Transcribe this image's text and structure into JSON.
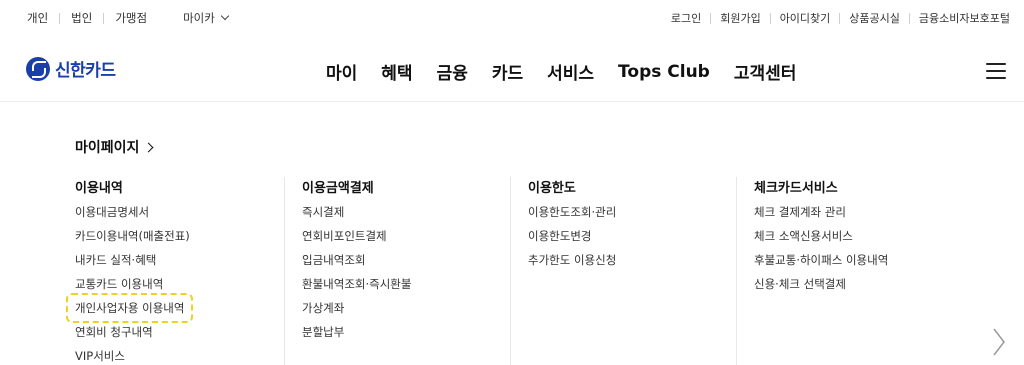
{
  "utility": {
    "left": [
      "개인",
      "법인",
      "가맹점"
    ],
    "myca": "마이카",
    "right": [
      "로그인",
      "회원가입",
      "아이디찾기",
      "상품공시실",
      "금융소비자보호포털"
    ]
  },
  "logo": {
    "text": "신한카드"
  },
  "nav": [
    "마이",
    "혜택",
    "금융",
    "카드",
    "서비스",
    "Tops Club",
    "고객센터"
  ],
  "mega": {
    "mypage_label": "마이페이지",
    "columns": [
      {
        "title": "이용내역",
        "items": [
          "이용대금명세서",
          "카드이용내역(매출전표)",
          "내카드 실적·혜택",
          "교통카드 이용내역",
          "개인사업자용 이용내역",
          "연회비 청구내역",
          "VIP서비스"
        ]
      },
      {
        "title": "이용금액결제",
        "items": [
          "즉시결제",
          "연회비포인트결제",
          "입금내역조회",
          "환불내역조회·즉시환불",
          "가상계좌",
          "분할납부"
        ]
      },
      {
        "title": "이용한도",
        "items": [
          "이용한도조회·관리",
          "이용한도변경",
          "추가한도 이용신청"
        ]
      },
      {
        "title": "체크카드서비스",
        "items": [
          "체크 결제계좌 관리",
          "체크 소액신용서비스",
          "후불교통·하이패스 이용내역",
          "신용·체크 선택결제"
        ]
      }
    ]
  },
  "colors": {
    "brand": "#1a3fa8",
    "highlight": "#f0d020"
  },
  "icons": {
    "next": "chevron-right-icon",
    "menu": "hamburger-menu-icon",
    "myca": "chevron-down-icon"
  }
}
